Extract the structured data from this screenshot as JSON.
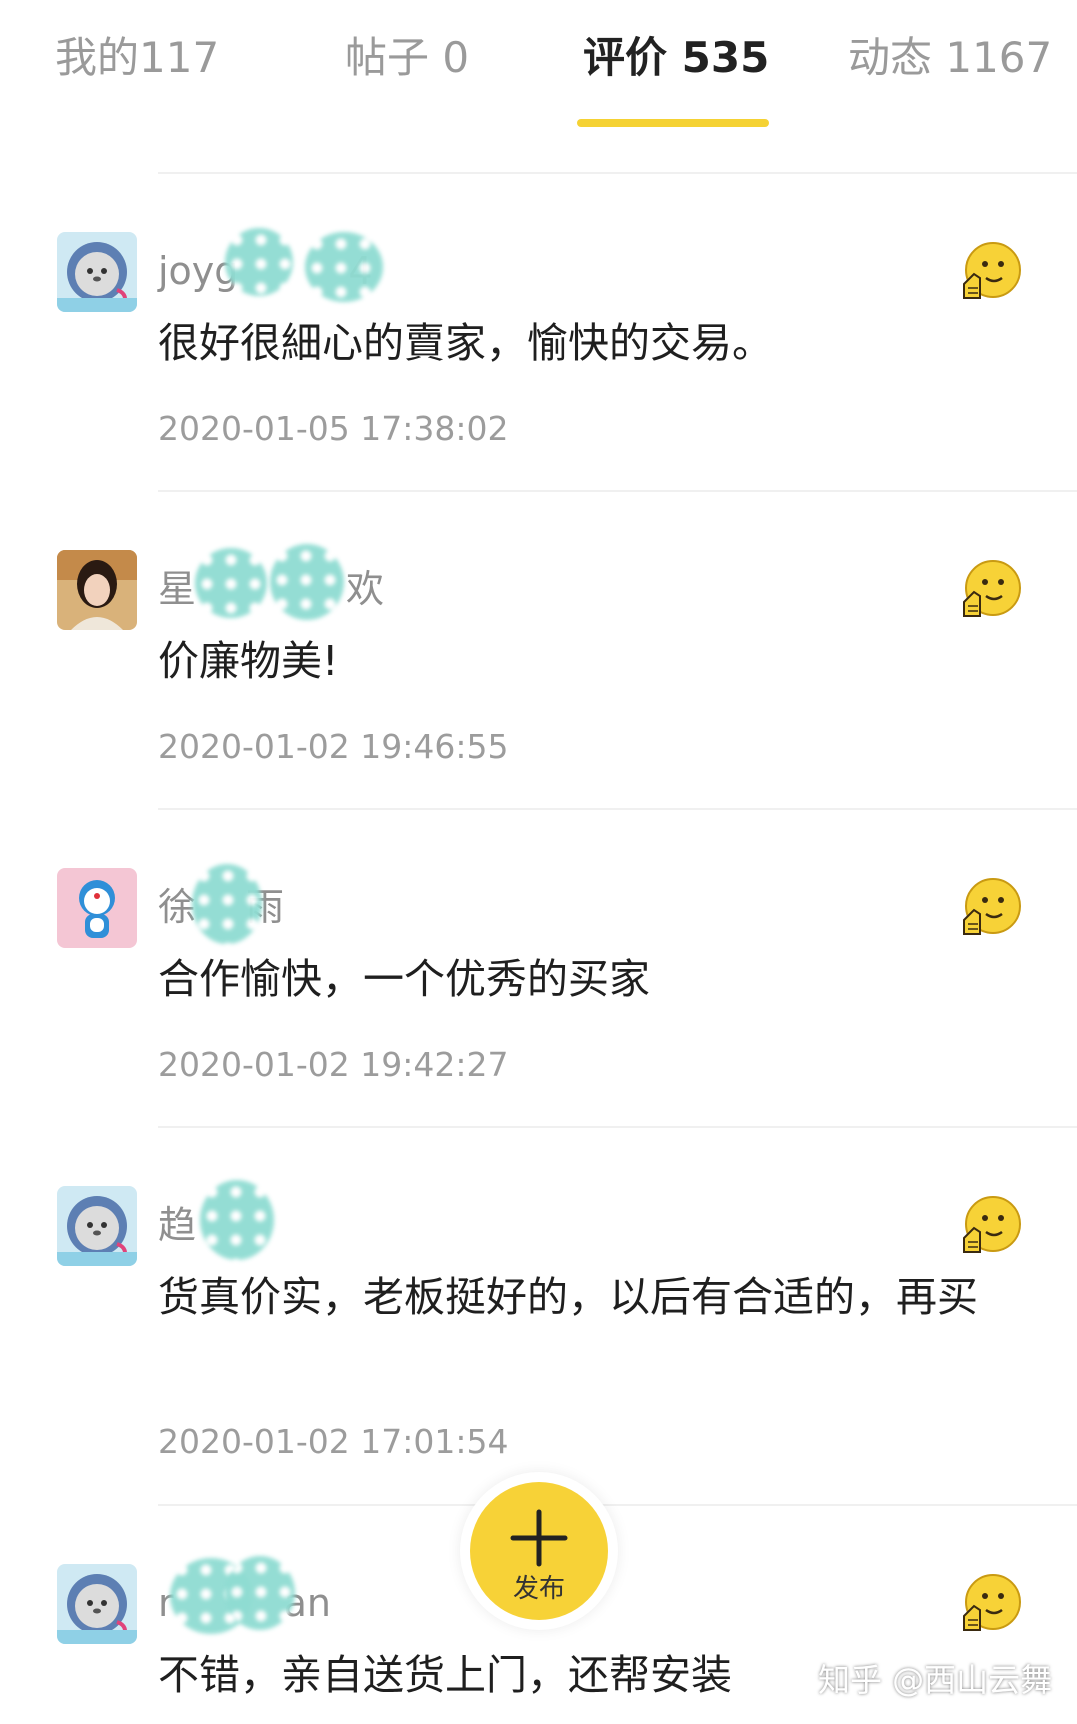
{
  "tabs": [
    {
      "label": "我的117",
      "active": false
    },
    {
      "label": "帖子 0",
      "active": false
    },
    {
      "label": "评价 535",
      "active": true
    },
    {
      "label": "动态 1167",
      "active": false
    }
  ],
  "accent_color": "#f5d234",
  "reviews": [
    {
      "username": "joyg",
      "username_tail": "4",
      "comment": "很好很細心的賣家，愉快的交易。",
      "timestamp": "2020-01-05 17:38:02",
      "avatar": "cat-astronaut-avatar"
    },
    {
      "username": "星",
      "username_tail": "欢",
      "comment": "价廉物美!",
      "timestamp": "2020-01-02 19:46:55",
      "avatar": "woman-photo-avatar"
    },
    {
      "username": "徐",
      "username_tail": "雨",
      "comment": "合作愉快，一个优秀的买家",
      "timestamp": "2020-01-02 19:42:27",
      "avatar": "doraemon-avatar"
    },
    {
      "username": "趋",
      "username_tail": "",
      "comment": "货真价实，老板挺好的，以后有合适的，再买",
      "timestamp": "2020-01-02 17:01:54",
      "avatar": "cat-astronaut-avatar"
    },
    {
      "username": "r",
      "username_tail": "an",
      "comment": "不错，亲自送货上门，还帮安装",
      "timestamp": "",
      "avatar": "cat-astronaut-avatar"
    }
  ],
  "fab": {
    "label": "发布",
    "icon": "plus-icon"
  },
  "watermark": "知乎 @西山云舞"
}
